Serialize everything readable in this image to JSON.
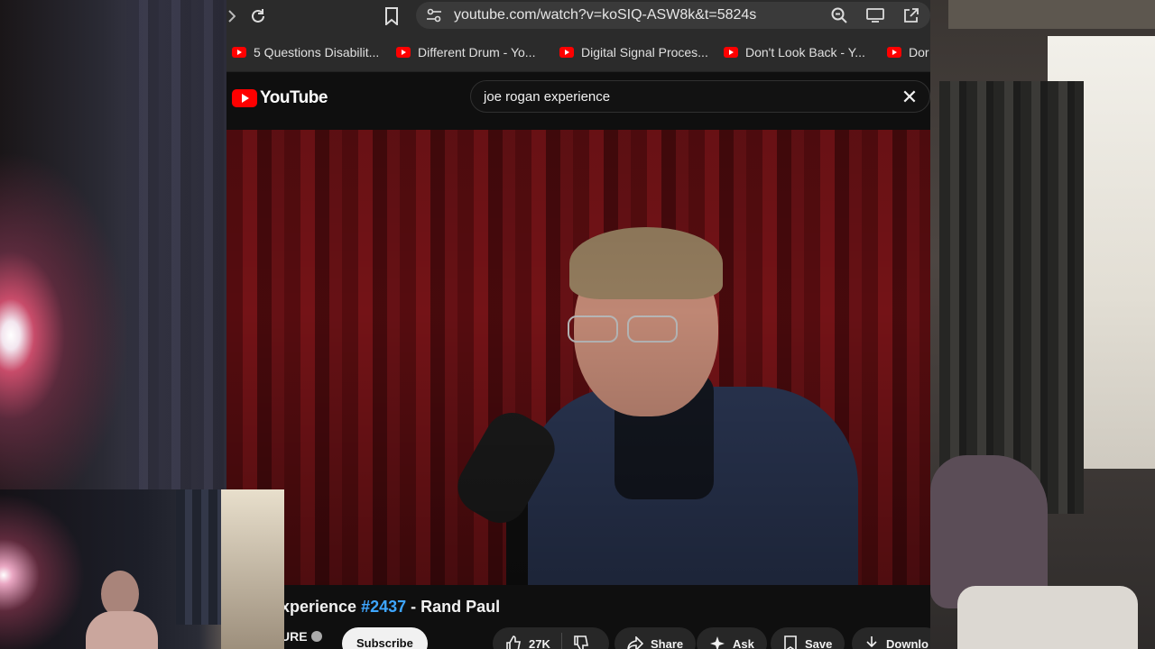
{
  "browser": {
    "url": "youtube.com/watch?v=koSIQ-ASW8k&t=5824s",
    "bookmarks": [
      {
        "label": "5 Questions Disabilit..."
      },
      {
        "label": "Different Drum - Yo..."
      },
      {
        "label": "Digital Signal Proces..."
      },
      {
        "label": "Don't Look Back - Y..."
      },
      {
        "label": "Dor"
      }
    ]
  },
  "youtube": {
    "logo_text": "YouTube",
    "search_value": "joe rogan experience",
    "video": {
      "title_prefix": "xperience ",
      "episode": "#2437",
      "title_suffix": " - Rand Paul"
    },
    "channel_fragment": "URE",
    "subscribe_label": "Subscribe",
    "like_count": "27K",
    "share_label": "Share",
    "ask_label": "Ask",
    "save_label": "Save",
    "download_label": "Downlo"
  },
  "colors": {
    "accent_red": "#ff0000",
    "hashtag_blue": "#3ea6ff",
    "bg": "#0f0f0f"
  }
}
